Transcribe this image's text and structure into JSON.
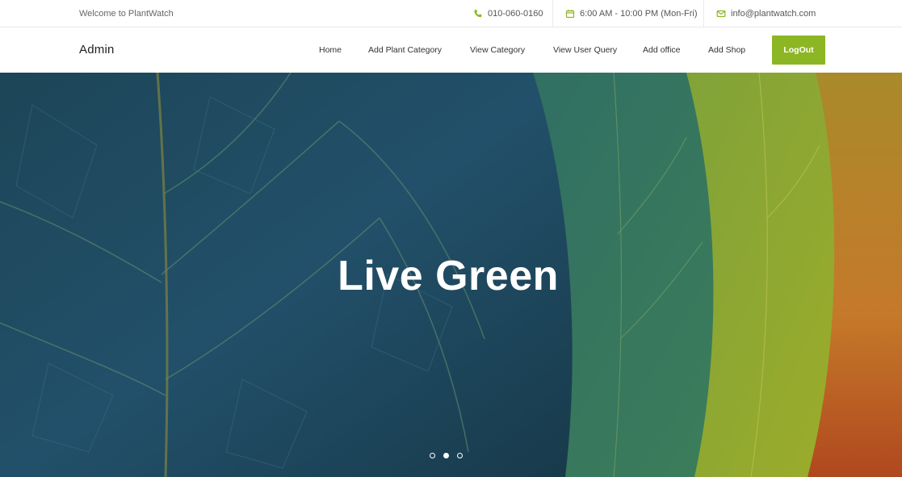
{
  "topbar": {
    "welcome": "Welcome to PlantWatch",
    "phone": "010-060-0160",
    "hours": "6:00 AM - 10:00 PM (Mon-Fri)",
    "email": "info@plantwatch.com"
  },
  "nav": {
    "brand": "Admin",
    "links": [
      "Home",
      "Add Plant Category",
      "View Category",
      "View User Query",
      "Add office",
      "Add Shop"
    ],
    "logout": "LogOut"
  },
  "hero": {
    "title": "Live Green",
    "slides": 3,
    "active_slide": 2
  },
  "colors": {
    "accent": "#8cb624",
    "leaf_blue": "#1f4a5e",
    "leaf_teal": "#3c7a5c",
    "leaf_green": "#8aa82c",
    "leaf_orange": "#c0761e"
  }
}
